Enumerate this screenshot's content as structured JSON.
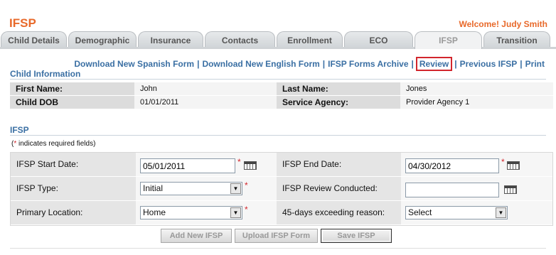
{
  "app": {
    "title": "IFSP",
    "welcome": "Welcome! Judy Smith"
  },
  "tabs": [
    {
      "label": "Child Details"
    },
    {
      "label": "Demographic"
    },
    {
      "label": "Insurance"
    },
    {
      "label": "Contacts"
    },
    {
      "label": "Enrollment"
    },
    {
      "label": "ECO"
    },
    {
      "label": "IFSP",
      "active": true
    },
    {
      "label": "Transition"
    }
  ],
  "links": [
    {
      "label": "Download New Spanish Form"
    },
    {
      "label": "Download New English Form"
    },
    {
      "label": "IFSP Forms Archive"
    },
    {
      "label": "Review",
      "highlighted": true
    },
    {
      "label": "Previous IFSP"
    },
    {
      "label": "Print"
    }
  ],
  "child_info": {
    "section_title": "Child Information",
    "first_name_label": "First Name:",
    "first_name": "John",
    "last_name_label": "Last Name:",
    "last_name": "Jones",
    "dob_label": "Child DOB",
    "dob": "01/01/2011",
    "agency_label": "Service Agency:",
    "agency": "Provider Agency 1"
  },
  "ifsp": {
    "section_title": "IFSP",
    "required_note_star": "*",
    "required_note": " indicates required fields)",
    "required_note_open": "(",
    "start_date_label": "IFSP Start Date:",
    "start_date": "05/01/2011",
    "end_date_label": "IFSP End Date:",
    "end_date": "04/30/2012",
    "type_label": "IFSP Type:",
    "type_value": "Initial",
    "review_label": "IFSP Review Conducted:",
    "review_value": "",
    "location_label": "Primary Location:",
    "location_value": "Home",
    "reason_label": "45-days exceeding reason:",
    "reason_value": "Select",
    "required_star": "*"
  },
  "buttons": {
    "add": "Add New IFSP",
    "upload": "Upload IFSP Form",
    "save": "Save IFSP"
  },
  "colors": {
    "accent": "#e8692a",
    "link": "#3a6fa3",
    "highlight": "#d2262d"
  }
}
